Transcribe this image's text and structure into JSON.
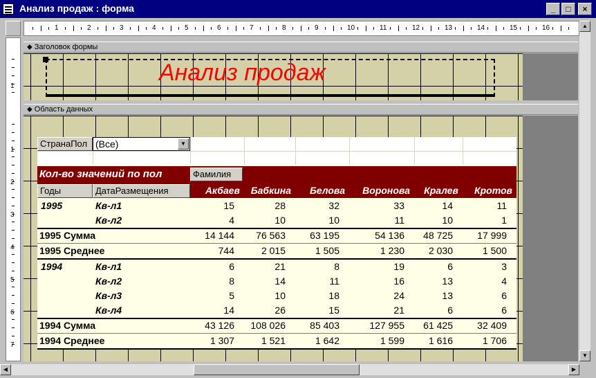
{
  "window": {
    "title": "Анализ продаж : форма"
  },
  "ruler": {
    "h_numbers": [
      "1",
      "2",
      "3",
      "4",
      "5",
      "6",
      "7",
      "8",
      "9",
      "10",
      "11",
      "12",
      "13",
      "14",
      "15",
      "16"
    ],
    "v_header": [
      "1"
    ],
    "v_data": [
      "1",
      "2",
      "3",
      "4",
      "5",
      "6",
      "7"
    ]
  },
  "sections": {
    "header_label": "Заголовок формы",
    "data_label": "Область данных"
  },
  "form_title": "Анализ продаж",
  "pivot": {
    "page_field": "СтранаПол",
    "page_value": "(Все)",
    "data_field": "Кол-во значений по пол",
    "column_field": "Фамилия",
    "row_fields": [
      "Годы",
      "ДатаРазмещения"
    ],
    "columns": [
      "Акбаев",
      "Бабкина",
      "Белова",
      "Воронова",
      "Кралев",
      "Кротов"
    ],
    "rows": [
      {
        "year": "1995",
        "q": "Кв-л1",
        "vals": [
          "15",
          "28",
          "32",
          "33",
          "14",
          "11"
        ]
      },
      {
        "year": "",
        "q": "Кв-л2",
        "vals": [
          "4",
          "10",
          "10",
          "11",
          "10",
          "1"
        ]
      },
      {
        "total": "1995 Сумма",
        "vals": [
          "14 144",
          "76 563",
          "63 195",
          "54 136",
          "48 725",
          "17 999"
        ]
      },
      {
        "total": "1995 Среднее",
        "vals": [
          "744",
          "2 015",
          "1 505",
          "1 230",
          "2 030",
          "1 500"
        ]
      },
      {
        "year": "1994",
        "q": "Кв-л1",
        "vals": [
          "6",
          "21",
          "8",
          "19",
          "6",
          "3"
        ]
      },
      {
        "year": "",
        "q": "Кв-л2",
        "vals": [
          "8",
          "14",
          "11",
          "16",
          "13",
          "4"
        ]
      },
      {
        "year": "",
        "q": "Кв-л3",
        "vals": [
          "5",
          "10",
          "18",
          "24",
          "13",
          "6"
        ]
      },
      {
        "year": "",
        "q": "Кв-л4",
        "vals": [
          "14",
          "26",
          "15",
          "21",
          "6",
          "6"
        ]
      },
      {
        "total": "1994 Сумма",
        "vals": [
          "43 126",
          "108 026",
          "85 403",
          "127 955",
          "61 425",
          "32 409"
        ]
      },
      {
        "total": "1994 Среднее",
        "vals": [
          "1 307",
          "1 521",
          "1 642",
          "1 599",
          "1 616",
          "1 706"
        ]
      }
    ]
  },
  "colors": {
    "title_bar": "#000080",
    "form_title": "#ff0000",
    "pivot_header": "#800000",
    "grid": "#d4d0a8",
    "background_dark": "#808080"
  }
}
